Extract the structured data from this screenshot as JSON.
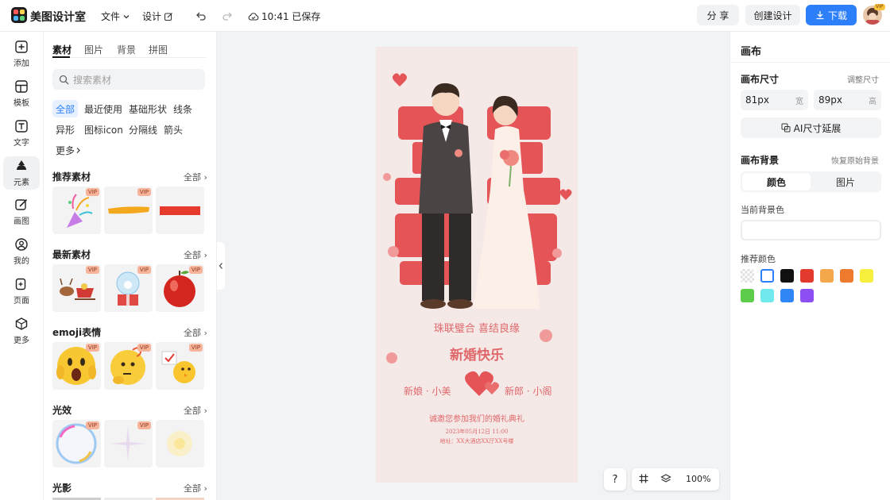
{
  "app": {
    "name": "美图设计室"
  },
  "topbar": {
    "menu_file": "文件",
    "menu_design": "设计",
    "save_status": "10:41 已保存",
    "share_label": "分 享",
    "create_label": "创建设计",
    "download_label": "下载",
    "avatar_badge": "VIP"
  },
  "leftnav": {
    "items": [
      {
        "label": "添加",
        "icon": "plus-square-icon"
      },
      {
        "label": "模板",
        "icon": "template-icon"
      },
      {
        "label": "文字",
        "icon": "text-icon"
      },
      {
        "label": "元素",
        "icon": "shapes-icon"
      },
      {
        "label": "画图",
        "icon": "pencil-icon"
      },
      {
        "label": "我的",
        "icon": "user-icon"
      },
      {
        "label": "页面",
        "icon": "page-add-icon"
      },
      {
        "label": "更多",
        "icon": "cube-icon"
      }
    ],
    "active": "元素"
  },
  "panel": {
    "tabs": [
      "素材",
      "图片",
      "背景",
      "拼图"
    ],
    "search_placeholder": "搜索素材",
    "chips": [
      "全部",
      "最近使用",
      "基础形状",
      "线条",
      "异形",
      "图标icon",
      "分隔线",
      "箭头",
      "更多"
    ],
    "sections": [
      {
        "title": "推荐素材",
        "all": "全部"
      },
      {
        "title": "最新素材",
        "all": "全部"
      },
      {
        "title": "emoji表情",
        "all": "全部"
      },
      {
        "title": "光效",
        "all": "全部"
      },
      {
        "title": "光影",
        "all": "全部"
      }
    ],
    "vip": "VIP"
  },
  "card": {
    "line1": "珠联璧合 喜结良缘",
    "title": "新婚快乐",
    "bride": "新娘 · 小美",
    "groom": "新郎 · 小阁",
    "invite": "诚邀您参加我们的婚礼典礼",
    "date": "2023年05月12日 11:00",
    "venue": "地址：XX大酒店XX厅XX号楼"
  },
  "bottom": {
    "help": "?",
    "zoom": "100%"
  },
  "right": {
    "title": "画布",
    "size_label": "画布尺寸",
    "adjust_size": "调整尺寸",
    "width_value": "81px",
    "width_unit": "宽",
    "height_value": "89px",
    "height_unit": "高",
    "ai_extend": "AI尺寸延展",
    "bg_label": "画布背景",
    "restore_bg": "恢复原始背景",
    "seg_color": "颜色",
    "seg_image": "图片",
    "current_bg": "当前背景色",
    "recommend": "推荐颜色",
    "colors": [
      "transparent",
      "#ffffff",
      "#111111",
      "#e23b2e",
      "#f5a74b",
      "#ee7a2d",
      "#f6ef3c",
      "#5dcc4a",
      "#6fe8ee",
      "#2f86f4",
      "#8d4ef2"
    ]
  }
}
